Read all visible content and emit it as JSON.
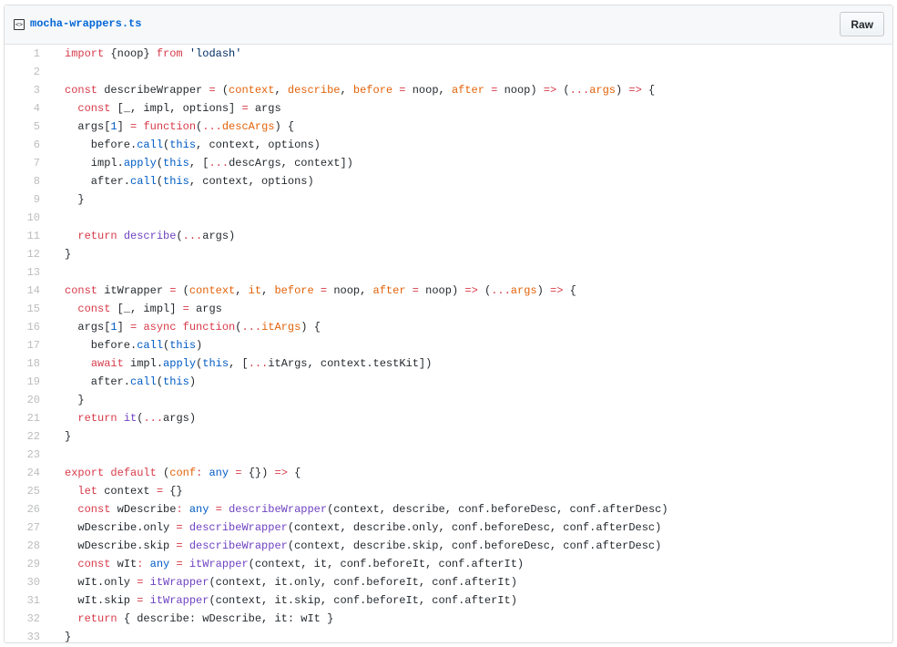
{
  "file": {
    "name": "mocha-wrappers.ts",
    "raw_label": "Raw",
    "icon": "code-file-icon"
  },
  "colors": {
    "keyword": "#d73a49",
    "param": "#e36209",
    "function": "#6f42c1",
    "constant": "#005cc5",
    "string": "#032f62",
    "link": "#0366d6"
  },
  "lines": [
    [
      [
        "k",
        "import"
      ],
      [
        "n",
        " {noop} "
      ],
      [
        "k",
        "from"
      ],
      [
        "s",
        " 'lodash'"
      ]
    ],
    [],
    [
      [
        "k",
        "const"
      ],
      [
        "n",
        " describeWrapper "
      ],
      [
        "k",
        "="
      ],
      [
        "n",
        " ("
      ],
      [
        "p",
        "context"
      ],
      [
        "n",
        ", "
      ],
      [
        "p",
        "describe"
      ],
      [
        "n",
        ", "
      ],
      [
        "p",
        "before"
      ],
      [
        "k",
        " = "
      ],
      [
        "n",
        "noop, "
      ],
      [
        "p",
        "after"
      ],
      [
        "k",
        " = "
      ],
      [
        "n",
        "noop) "
      ],
      [
        "k",
        "=>"
      ],
      [
        "n",
        " ("
      ],
      [
        "k",
        "..."
      ],
      [
        "p",
        "args"
      ],
      [
        "n",
        ") "
      ],
      [
        "k",
        "=>"
      ],
      [
        "n",
        " {"
      ]
    ],
    [
      [
        "n",
        "  "
      ],
      [
        "k",
        "const"
      ],
      [
        "n",
        " [_, impl, options] "
      ],
      [
        "k",
        "="
      ],
      [
        "n",
        " args"
      ]
    ],
    [
      [
        "n",
        "  args["
      ],
      [
        "c",
        "1"
      ],
      [
        "n",
        "] "
      ],
      [
        "k",
        "="
      ],
      [
        "n",
        " "
      ],
      [
        "k",
        "function"
      ],
      [
        "n",
        "("
      ],
      [
        "k",
        "..."
      ],
      [
        "p",
        "descArgs"
      ],
      [
        "n",
        ") {"
      ]
    ],
    [
      [
        "n",
        "    before."
      ],
      [
        "c",
        "call"
      ],
      [
        "n",
        "("
      ],
      [
        "c",
        "this"
      ],
      [
        "n",
        ", context, options)"
      ]
    ],
    [
      [
        "n",
        "    impl."
      ],
      [
        "c",
        "apply"
      ],
      [
        "n",
        "("
      ],
      [
        "c",
        "this"
      ],
      [
        "n",
        ", ["
      ],
      [
        "k",
        "..."
      ],
      [
        "n",
        "descArgs, context])"
      ]
    ],
    [
      [
        "n",
        "    after."
      ],
      [
        "c",
        "call"
      ],
      [
        "n",
        "("
      ],
      [
        "c",
        "this"
      ],
      [
        "n",
        ", context, options)"
      ]
    ],
    [
      [
        "n",
        "  }"
      ]
    ],
    [],
    [
      [
        "n",
        "  "
      ],
      [
        "k",
        "return"
      ],
      [
        "n",
        " "
      ],
      [
        "f",
        "describe"
      ],
      [
        "n",
        "("
      ],
      [
        "k",
        "..."
      ],
      [
        "n",
        "args)"
      ]
    ],
    [
      [
        "n",
        "}"
      ]
    ],
    [],
    [
      [
        "k",
        "const"
      ],
      [
        "n",
        " itWrapper "
      ],
      [
        "k",
        "="
      ],
      [
        "n",
        " ("
      ],
      [
        "p",
        "context"
      ],
      [
        "n",
        ", "
      ],
      [
        "p",
        "it"
      ],
      [
        "n",
        ", "
      ],
      [
        "p",
        "before"
      ],
      [
        "k",
        " = "
      ],
      [
        "n",
        "noop, "
      ],
      [
        "p",
        "after"
      ],
      [
        "k",
        " = "
      ],
      [
        "n",
        "noop) "
      ],
      [
        "k",
        "=>"
      ],
      [
        "n",
        " ("
      ],
      [
        "k",
        "..."
      ],
      [
        "p",
        "args"
      ],
      [
        "n",
        ") "
      ],
      [
        "k",
        "=>"
      ],
      [
        "n",
        " {"
      ]
    ],
    [
      [
        "n",
        "  "
      ],
      [
        "k",
        "const"
      ],
      [
        "n",
        " [_, impl] "
      ],
      [
        "k",
        "="
      ],
      [
        "n",
        " args"
      ]
    ],
    [
      [
        "n",
        "  args["
      ],
      [
        "c",
        "1"
      ],
      [
        "n",
        "] "
      ],
      [
        "k",
        "="
      ],
      [
        "n",
        " "
      ],
      [
        "k",
        "async function"
      ],
      [
        "n",
        "("
      ],
      [
        "k",
        "..."
      ],
      [
        "p",
        "itArgs"
      ],
      [
        "n",
        ") {"
      ]
    ],
    [
      [
        "n",
        "    before."
      ],
      [
        "c",
        "call"
      ],
      [
        "n",
        "("
      ],
      [
        "c",
        "this"
      ],
      [
        "n",
        ")"
      ]
    ],
    [
      [
        "n",
        "    "
      ],
      [
        "k",
        "await"
      ],
      [
        "n",
        " impl."
      ],
      [
        "c",
        "apply"
      ],
      [
        "n",
        "("
      ],
      [
        "c",
        "this"
      ],
      [
        "n",
        ", ["
      ],
      [
        "k",
        "..."
      ],
      [
        "n",
        "itArgs, context.testKit])"
      ]
    ],
    [
      [
        "n",
        "    after."
      ],
      [
        "c",
        "call"
      ],
      [
        "n",
        "("
      ],
      [
        "c",
        "this"
      ],
      [
        "n",
        ")"
      ]
    ],
    [
      [
        "n",
        "  }"
      ]
    ],
    [
      [
        "n",
        "  "
      ],
      [
        "k",
        "return"
      ],
      [
        "n",
        " "
      ],
      [
        "f",
        "it"
      ],
      [
        "n",
        "("
      ],
      [
        "k",
        "..."
      ],
      [
        "n",
        "args)"
      ]
    ],
    [
      [
        "n",
        "}"
      ]
    ],
    [],
    [
      [
        "k",
        "export"
      ],
      [
        "n",
        " "
      ],
      [
        "k",
        "default"
      ],
      [
        "n",
        " ("
      ],
      [
        "p",
        "conf"
      ],
      [
        "k",
        ":"
      ],
      [
        "n",
        " "
      ],
      [
        "c",
        "any"
      ],
      [
        "k",
        " = "
      ],
      [
        "n",
        "{}) "
      ],
      [
        "k",
        "=>"
      ],
      [
        "n",
        " {"
      ]
    ],
    [
      [
        "n",
        "  "
      ],
      [
        "k",
        "let"
      ],
      [
        "n",
        " context "
      ],
      [
        "k",
        "="
      ],
      [
        "n",
        " {}"
      ]
    ],
    [
      [
        "n",
        "  "
      ],
      [
        "k",
        "const"
      ],
      [
        "n",
        " wDescribe"
      ],
      [
        "k",
        ":"
      ],
      [
        "n",
        " "
      ],
      [
        "c",
        "any"
      ],
      [
        "k",
        " = "
      ],
      [
        "f",
        "describeWrapper"
      ],
      [
        "n",
        "(context, describe, conf.beforeDesc, conf.afterDesc)"
      ]
    ],
    [
      [
        "n",
        "  wDescribe.only "
      ],
      [
        "k",
        "="
      ],
      [
        "n",
        " "
      ],
      [
        "f",
        "describeWrapper"
      ],
      [
        "n",
        "(context, describe.only, conf.beforeDesc, conf.afterDesc)"
      ]
    ],
    [
      [
        "n",
        "  wDescribe.skip "
      ],
      [
        "k",
        "="
      ],
      [
        "n",
        " "
      ],
      [
        "f",
        "describeWrapper"
      ],
      [
        "n",
        "(context, describe.skip, conf.beforeDesc, conf.afterDesc)"
      ]
    ],
    [
      [
        "n",
        "  "
      ],
      [
        "k",
        "const"
      ],
      [
        "n",
        " wIt"
      ],
      [
        "k",
        ":"
      ],
      [
        "n",
        " "
      ],
      [
        "c",
        "any"
      ],
      [
        "k",
        " = "
      ],
      [
        "f",
        "itWrapper"
      ],
      [
        "n",
        "(context, it, conf.beforeIt, conf.afterIt)"
      ]
    ],
    [
      [
        "n",
        "  wIt.only "
      ],
      [
        "k",
        "="
      ],
      [
        "n",
        " "
      ],
      [
        "f",
        "itWrapper"
      ],
      [
        "n",
        "(context, it.only, conf.beforeIt, conf.afterIt)"
      ]
    ],
    [
      [
        "n",
        "  wIt.skip "
      ],
      [
        "k",
        "="
      ],
      [
        "n",
        " "
      ],
      [
        "f",
        "itWrapper"
      ],
      [
        "n",
        "(context, it.skip, conf.beforeIt, conf.afterIt)"
      ]
    ],
    [
      [
        "n",
        "  "
      ],
      [
        "k",
        "return"
      ],
      [
        "n",
        " { describe: wDescribe, it: wIt }"
      ]
    ],
    [
      [
        "n",
        "}"
      ]
    ]
  ],
  "line_numbers": [
    "1",
    "2",
    "3",
    "4",
    "5",
    "6",
    "7",
    "8",
    "9",
    "10",
    "11",
    "12",
    "13",
    "14",
    "15",
    "16",
    "17",
    "18",
    "19",
    "20",
    "21",
    "22",
    "23",
    "24",
    "25",
    "26",
    "27",
    "28",
    "29",
    "30",
    "31",
    "32",
    "33"
  ]
}
